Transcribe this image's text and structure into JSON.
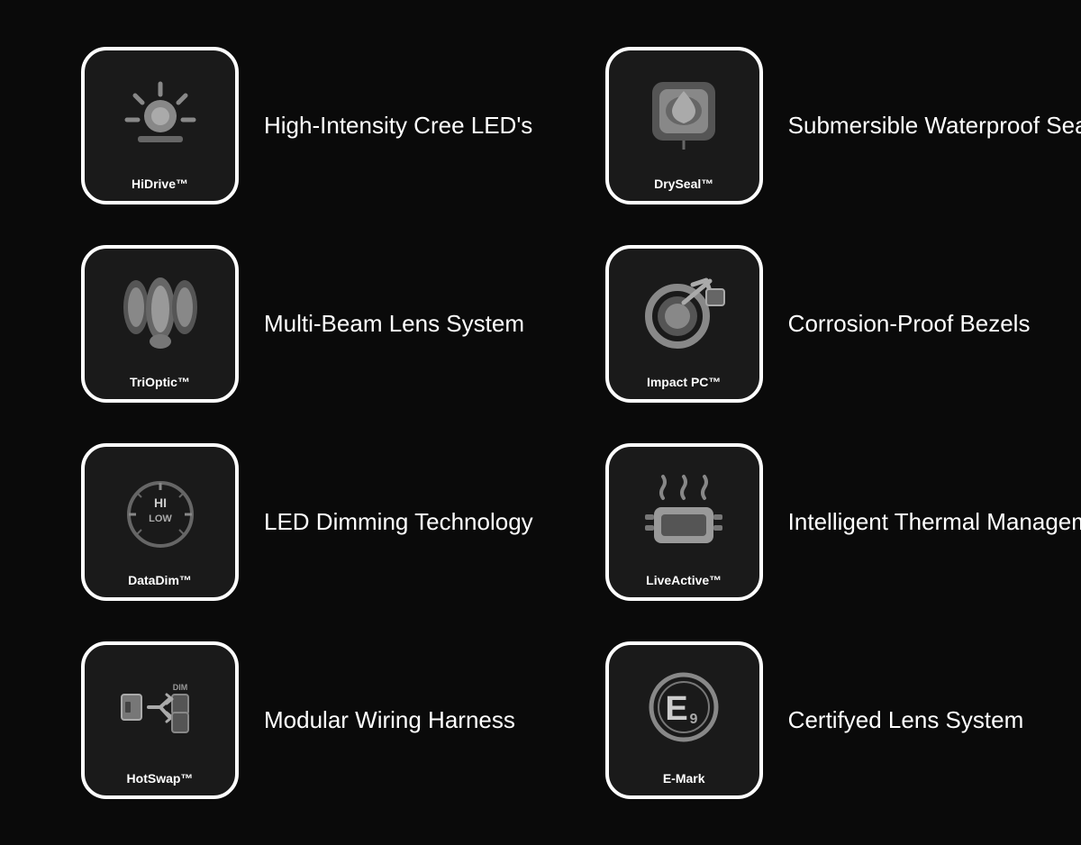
{
  "features": [
    {
      "id": "hidrive",
      "brand": "HiDrive™",
      "description": "High-Intensity Cree LED's"
    },
    {
      "id": "dryseal",
      "brand": "DrySeal™",
      "description": "Submersible Waterproof Seal"
    },
    {
      "id": "trioptic",
      "brand": "TriOptic™",
      "description": "Multi-Beam Lens System"
    },
    {
      "id": "impactpc",
      "brand": "Impact PC™",
      "description": "Corrosion-Proof Bezels"
    },
    {
      "id": "datadim",
      "brand": "DataDim™",
      "description": "LED Dimming Technology"
    },
    {
      "id": "liveactive",
      "brand": "LiveActive™",
      "description": "Intelligent Thermal Management"
    },
    {
      "id": "hotswap",
      "brand": "HotSwap™",
      "description": "Modular Wiring Harness"
    },
    {
      "id": "emark",
      "brand": "E-Mark",
      "description": "Certifyed Lens System"
    }
  ]
}
